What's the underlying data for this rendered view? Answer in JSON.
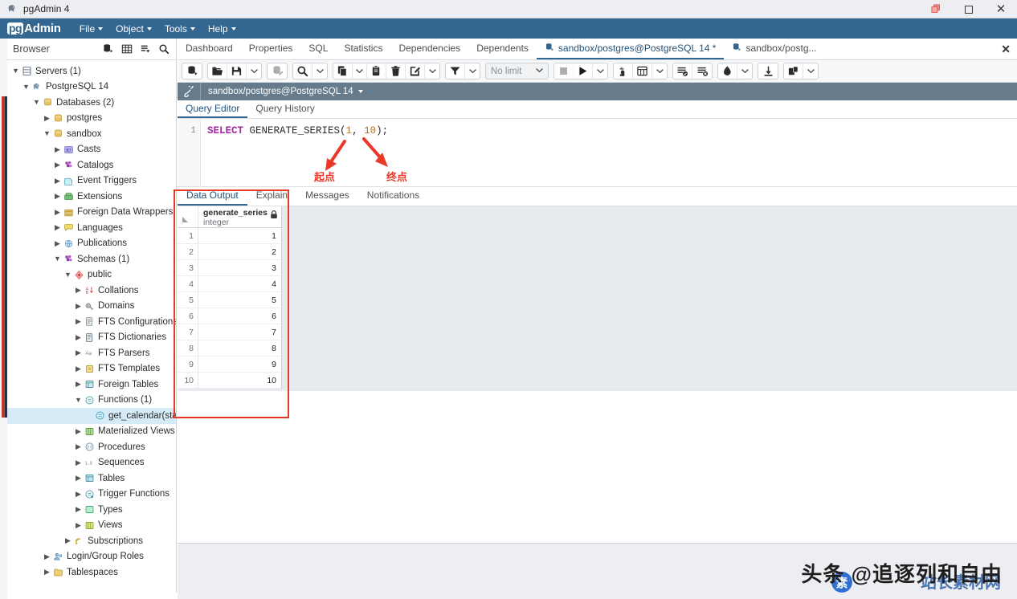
{
  "window": {
    "title": "pgAdmin 4",
    "app_icon": "elephant-icon",
    "minimize_label": "Minimize",
    "maximize_label": "Maximize",
    "close_label": "Close"
  },
  "brand": {
    "pg": "pg",
    "admin": "Admin"
  },
  "menubar": {
    "items": [
      "File",
      "Object",
      "Tools",
      "Help"
    ]
  },
  "browser": {
    "title": "Browser",
    "header_icons": [
      "object-explorer-icon",
      "grid-icon",
      "filter-icon",
      "search-icon"
    ],
    "tree": [
      {
        "label": "Servers (1)",
        "depth": 0,
        "state": "open",
        "icon": "servers-icon",
        "sel": false
      },
      {
        "label": "PostgreSQL 14",
        "depth": 1,
        "state": "open",
        "icon": "postgres-icon",
        "sel": false
      },
      {
        "label": "Databases (2)",
        "depth": 2,
        "state": "open",
        "icon": "databases-icon",
        "sel": false
      },
      {
        "label": "postgres",
        "depth": 3,
        "state": "closed",
        "icon": "database-icon",
        "sel": false
      },
      {
        "label": "sandbox",
        "depth": 3,
        "state": "open",
        "icon": "database-icon",
        "sel": false
      },
      {
        "label": "Casts",
        "depth": 4,
        "state": "closed",
        "icon": "casts-icon",
        "sel": false
      },
      {
        "label": "Catalogs",
        "depth": 4,
        "state": "closed",
        "icon": "catalogs-icon",
        "sel": false
      },
      {
        "label": "Event Triggers",
        "depth": 4,
        "state": "closed",
        "icon": "event-triggers-icon",
        "sel": false
      },
      {
        "label": "Extensions",
        "depth": 4,
        "state": "closed",
        "icon": "extensions-icon",
        "sel": false
      },
      {
        "label": "Foreign Data Wrappers",
        "depth": 4,
        "state": "closed",
        "icon": "fdw-icon",
        "sel": false
      },
      {
        "label": "Languages",
        "depth": 4,
        "state": "closed",
        "icon": "languages-icon",
        "sel": false
      },
      {
        "label": "Publications",
        "depth": 4,
        "state": "closed",
        "icon": "publications-icon",
        "sel": false
      },
      {
        "label": "Schemas (1)",
        "depth": 4,
        "state": "open",
        "icon": "schemas-icon",
        "sel": false
      },
      {
        "label": "public",
        "depth": 5,
        "state": "open",
        "icon": "schema-icon",
        "sel": false
      },
      {
        "label": "Collations",
        "depth": 6,
        "state": "closed",
        "icon": "collations-icon",
        "sel": false
      },
      {
        "label": "Domains",
        "depth": 6,
        "state": "closed",
        "icon": "domains-icon",
        "sel": false
      },
      {
        "label": "FTS Configurations",
        "depth": 6,
        "state": "closed",
        "icon": "fts-config-icon",
        "sel": false
      },
      {
        "label": "FTS Dictionaries",
        "depth": 6,
        "state": "closed",
        "icon": "fts-dict-icon",
        "sel": false
      },
      {
        "label": "FTS Parsers",
        "depth": 6,
        "state": "closed",
        "icon": "fts-parser-icon",
        "sel": false
      },
      {
        "label": "FTS Templates",
        "depth": 6,
        "state": "closed",
        "icon": "fts-template-icon",
        "sel": false
      },
      {
        "label": "Foreign Tables",
        "depth": 6,
        "state": "closed",
        "icon": "foreign-tables-icon",
        "sel": false
      },
      {
        "label": "Functions (1)",
        "depth": 6,
        "state": "open",
        "icon": "functions-icon",
        "sel": false
      },
      {
        "label": "get_calendar(start",
        "depth": 7,
        "state": "leaf",
        "icon": "function-icon",
        "sel": true
      },
      {
        "label": "Materialized Views",
        "depth": 6,
        "state": "closed",
        "icon": "mat-views-icon",
        "sel": false
      },
      {
        "label": "Procedures",
        "depth": 6,
        "state": "closed",
        "icon": "procedures-icon",
        "sel": false
      },
      {
        "label": "Sequences",
        "depth": 6,
        "state": "closed",
        "icon": "sequences-icon",
        "sel": false
      },
      {
        "label": "Tables",
        "depth": 6,
        "state": "closed",
        "icon": "tables-icon",
        "sel": false
      },
      {
        "label": "Trigger Functions",
        "depth": 6,
        "state": "closed",
        "icon": "trigger-functions-icon",
        "sel": false
      },
      {
        "label": "Types",
        "depth": 6,
        "state": "closed",
        "icon": "types-icon",
        "sel": false
      },
      {
        "label": "Views",
        "depth": 6,
        "state": "closed",
        "icon": "views-icon",
        "sel": false
      },
      {
        "label": "Subscriptions",
        "depth": 5,
        "state": "closed",
        "icon": "subscriptions-icon",
        "sel": false
      },
      {
        "label": "Login/Group Roles",
        "depth": 3,
        "state": "closed",
        "icon": "roles-icon",
        "sel": false
      },
      {
        "label": "Tablespaces",
        "depth": 3,
        "state": "closed",
        "icon": "tablespaces-icon",
        "sel": false
      }
    ]
  },
  "top_tabs": {
    "items": [
      {
        "label": "Dashboard",
        "active": false,
        "icon": ""
      },
      {
        "label": "Properties",
        "active": false,
        "icon": ""
      },
      {
        "label": "SQL",
        "active": false,
        "icon": ""
      },
      {
        "label": "Statistics",
        "active": false,
        "icon": ""
      },
      {
        "label": "Dependencies",
        "active": false,
        "icon": ""
      },
      {
        "label": "Dependents",
        "active": false,
        "icon": ""
      },
      {
        "label": "sandbox/postgres@PostgreSQL 14 *",
        "active": true,
        "icon": "query-tool-icon"
      },
      {
        "label": "sandbox/postg...",
        "active": false,
        "icon": "query-tool-icon"
      }
    ],
    "close_label": "✕"
  },
  "query_toolbar": {
    "groups": [
      {
        "buttons": [
          {
            "icon": "open-connection-icon",
            "disabled": false
          }
        ]
      },
      {
        "buttons": [
          {
            "icon": "open-file-icon",
            "disabled": false
          },
          {
            "icon": "save-file-icon",
            "disabled": false
          },
          {
            "icon": "chevron-down-icon",
            "disabled": false,
            "narrow": true
          }
        ]
      },
      {
        "buttons": [
          {
            "icon": "edit-data-icon",
            "disabled": true
          }
        ]
      },
      {
        "buttons": [
          {
            "icon": "find-icon",
            "disabled": false
          },
          {
            "icon": "chevron-down-icon",
            "disabled": false,
            "narrow": true
          }
        ]
      },
      {
        "buttons": [
          {
            "icon": "copy-icon",
            "disabled": false
          },
          {
            "icon": "chevron-down-icon",
            "disabled": false,
            "narrow": true
          },
          {
            "icon": "paste-icon",
            "disabled": false
          },
          {
            "icon": "delete-icon",
            "disabled": false
          },
          {
            "icon": "edit-pencil-icon",
            "disabled": false
          },
          {
            "icon": "chevron-down-icon",
            "disabled": false,
            "narrow": true
          }
        ]
      },
      {
        "buttons": [
          {
            "icon": "filter-icon",
            "disabled": false
          },
          {
            "icon": "chevron-down-icon",
            "disabled": false,
            "narrow": true
          }
        ]
      }
    ],
    "row_limit": {
      "value": "No limit",
      "caret": "chevron-down-icon"
    },
    "groups2": [
      {
        "buttons": [
          {
            "icon": "stop-icon",
            "disabled": true
          },
          {
            "icon": "execute-play-icon",
            "disabled": false
          },
          {
            "icon": "chevron-down-icon",
            "disabled": false,
            "narrow": true
          }
        ]
      },
      {
        "buttons": [
          {
            "icon": "explain-icon",
            "disabled": false
          },
          {
            "icon": "explain-analyze-icon",
            "disabled": false
          },
          {
            "icon": "chevron-down-icon",
            "disabled": false,
            "narrow": true
          }
        ]
      },
      {
        "buttons": [
          {
            "icon": "commit-icon",
            "disabled": false
          },
          {
            "icon": "rollback-icon",
            "disabled": false
          }
        ]
      },
      {
        "buttons": [
          {
            "icon": "clear-icon",
            "disabled": false
          },
          {
            "icon": "chevron-down-icon",
            "disabled": false,
            "narrow": true
          }
        ]
      },
      {
        "buttons": [
          {
            "icon": "download-csv-icon",
            "disabled": false
          }
        ]
      },
      {
        "buttons": [
          {
            "icon": "macros-icon",
            "disabled": false
          },
          {
            "icon": "chevron-down-icon",
            "disabled": false,
            "narrow": true
          }
        ]
      }
    ]
  },
  "connection_bar": {
    "icon": "connection-icon",
    "text": "sandbox/postgres@PostgreSQL 14",
    "caret": "chevron-down-icon"
  },
  "editor_tabs": {
    "items": [
      {
        "label": "Query Editor",
        "active": true
      },
      {
        "label": "Query History",
        "active": false
      }
    ]
  },
  "editor": {
    "line_number": "1",
    "tokens": [
      {
        "text": "SELECT",
        "type": "keyword"
      },
      {
        "text": " GENERATE_SERIES(",
        "type": "plain"
      },
      {
        "text": "1",
        "type": "number"
      },
      {
        "text": ", ",
        "type": "plain"
      },
      {
        "text": "10",
        "type": "number"
      },
      {
        "text": ");",
        "type": "plain"
      }
    ]
  },
  "annotations": [
    {
      "name": "start-point-annotation",
      "label": "起点",
      "arrow": "down-left-arrow"
    },
    {
      "name": "end-point-annotation",
      "label": "终点",
      "arrow": "down-right-arrow"
    }
  ],
  "result_tabs": {
    "items": [
      {
        "label": "Data Output",
        "active": true
      },
      {
        "label": "Explain",
        "active": false
      },
      {
        "label": "Messages",
        "active": false
      },
      {
        "label": "Notifications",
        "active": false
      }
    ]
  },
  "data_grid": {
    "column": {
      "name": "generate_series",
      "type": "integer",
      "lock_icon": "lock-icon"
    },
    "rows": [
      {
        "n": "1",
        "v": "1"
      },
      {
        "n": "2",
        "v": "2"
      },
      {
        "n": "3",
        "v": "3"
      },
      {
        "n": "4",
        "v": "4"
      },
      {
        "n": "5",
        "v": "5"
      },
      {
        "n": "6",
        "v": "6"
      },
      {
        "n": "7",
        "v": "7"
      },
      {
        "n": "8",
        "v": "8"
      },
      {
        "n": "9",
        "v": "9"
      },
      {
        "n": "10",
        "v": "10"
      }
    ]
  },
  "watermark": {
    "text": "头条 @追逐列和自由",
    "overlay": "站长素材网",
    "logo": "素"
  },
  "colors": {
    "brand_blue": "#336791",
    "accent_red": "#e8392a",
    "tab_active": "#22527b",
    "selection_blue": "#d6ebf8",
    "conn_bar": "#667c8c",
    "keyword_purple": "#a626a4",
    "number_orange": "#b4762b"
  }
}
